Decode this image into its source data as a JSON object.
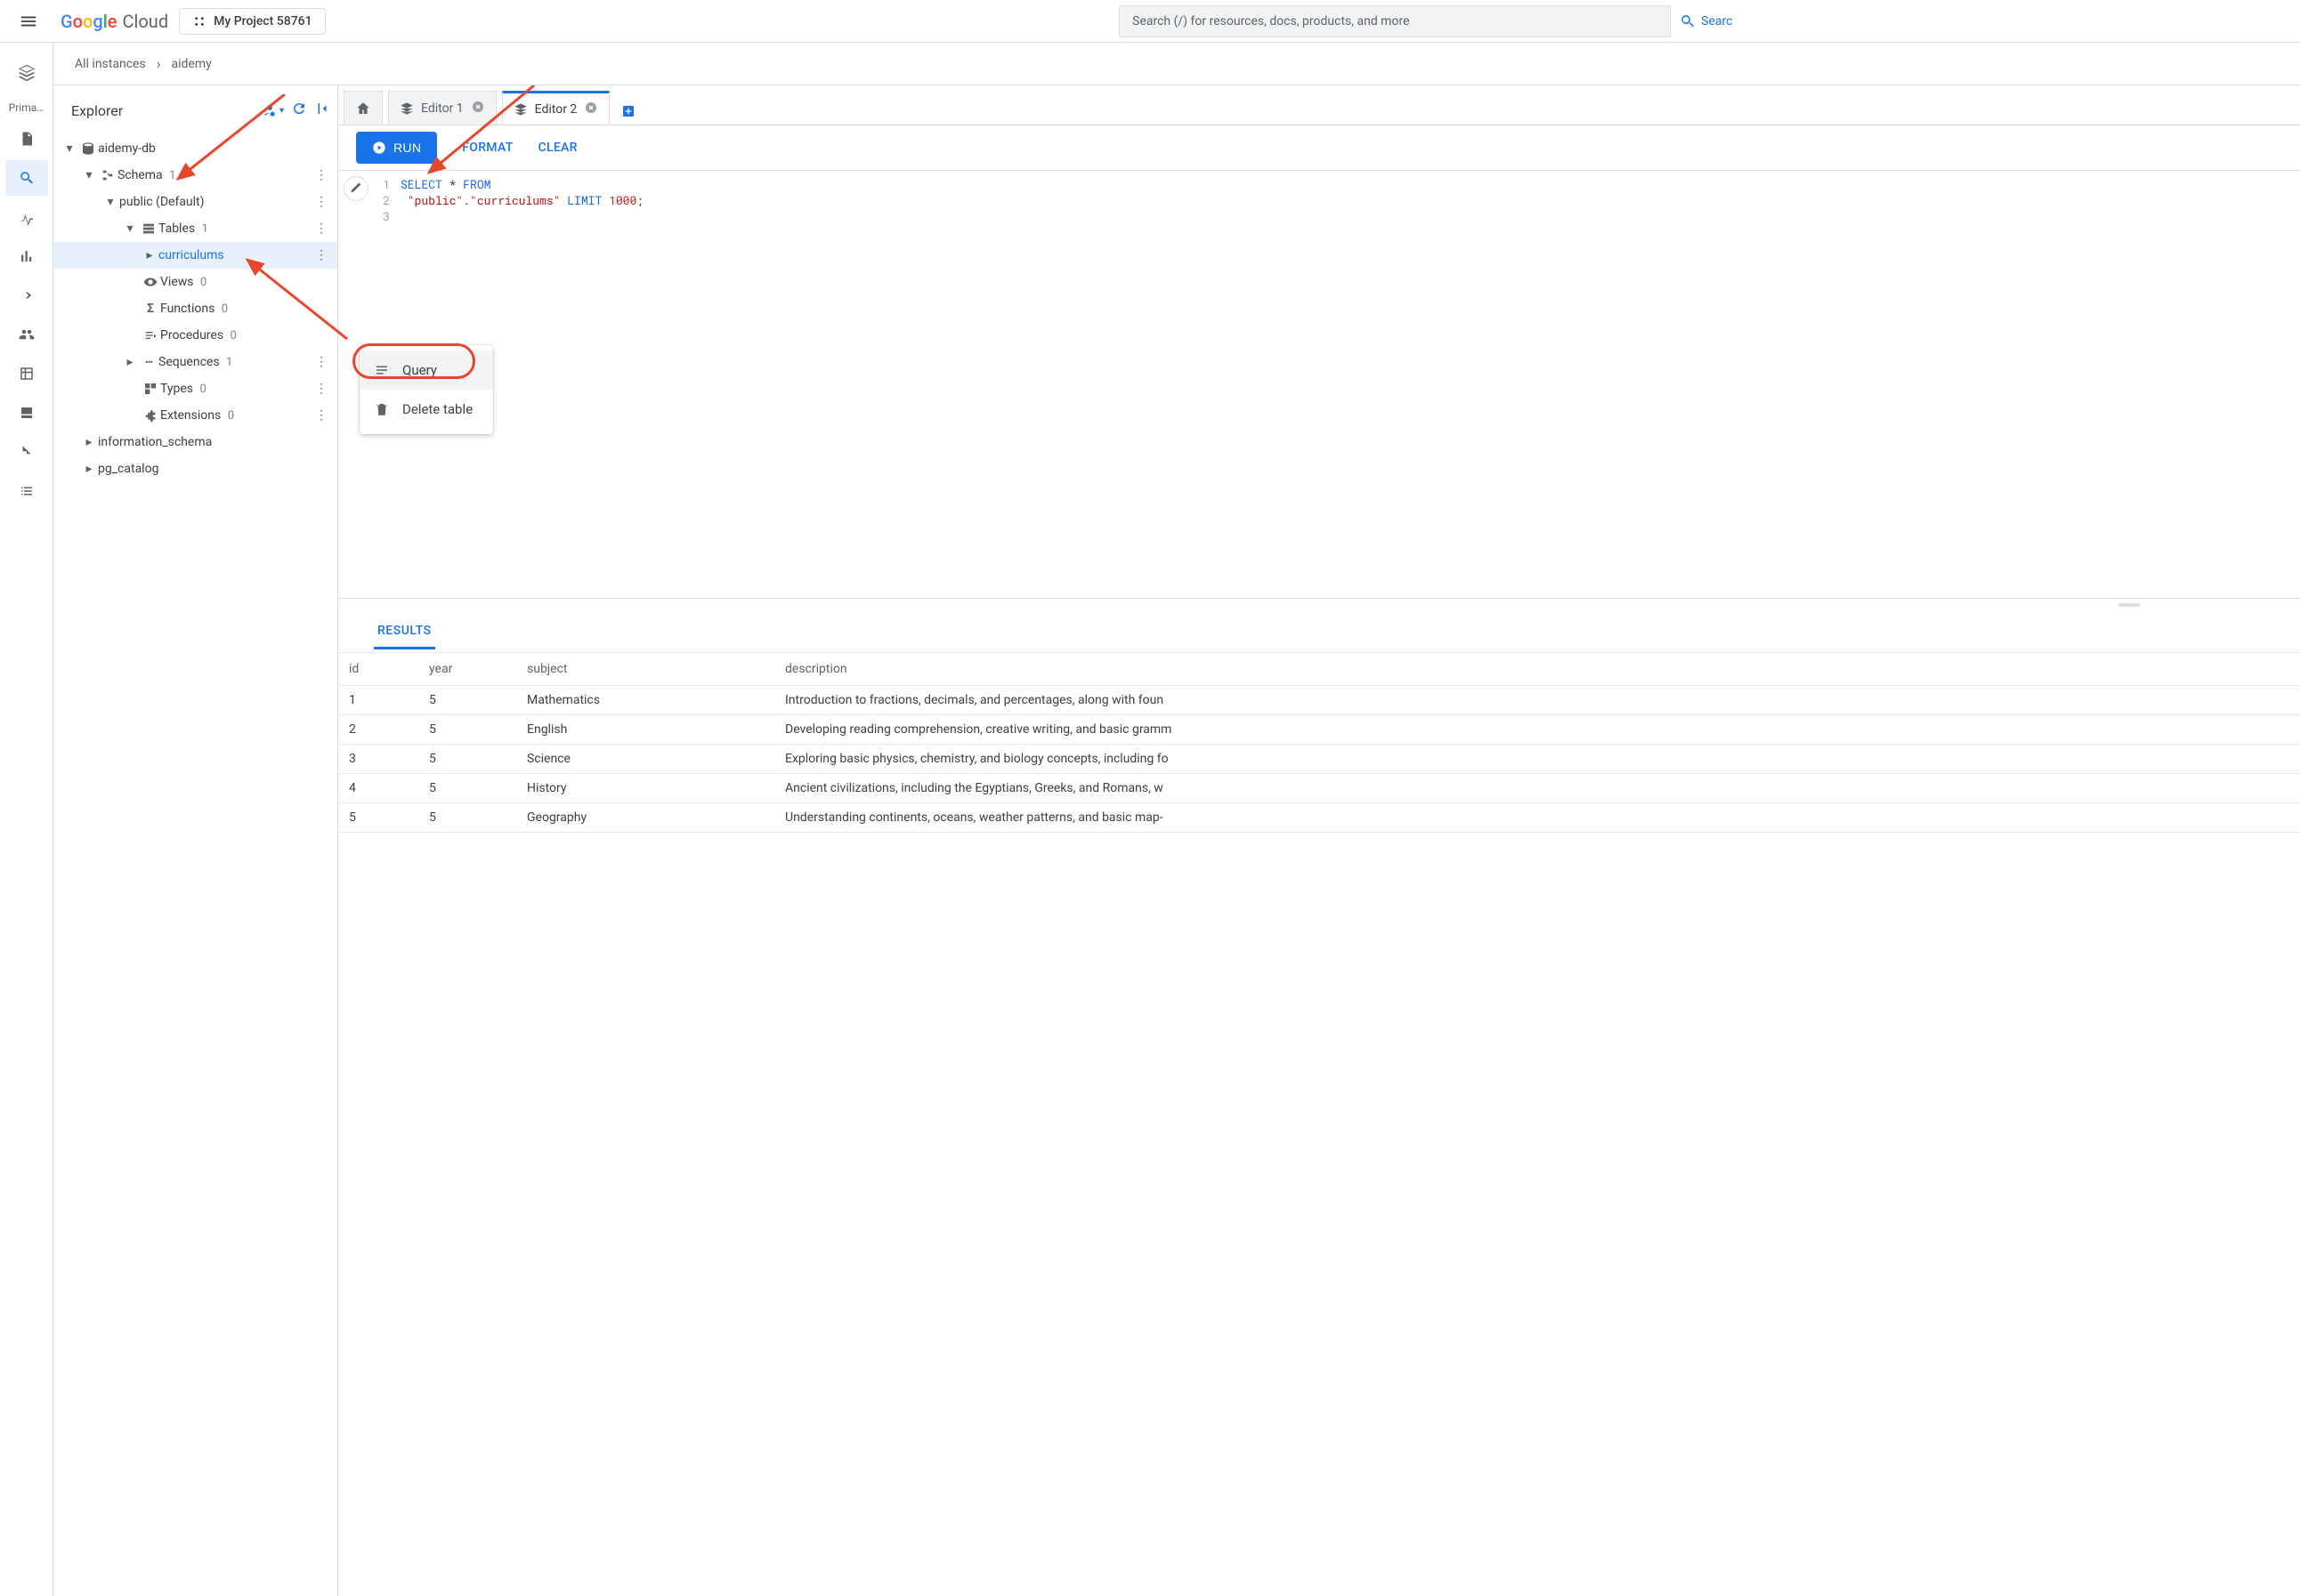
{
  "header": {
    "logo_cloud": "Cloud",
    "project": "My Project 58761",
    "search_placeholder": "Search (/) for resources, docs, products, and more",
    "search_button": "Searc"
  },
  "rail": {
    "section_label": "Prima…"
  },
  "breadcrumb": {
    "root": "All instances",
    "current": "aidemy"
  },
  "explorer": {
    "title": "Explorer",
    "db": "aidemy-db",
    "schema_label": "Schema",
    "schema_count": "1",
    "public_label": "public (Default)",
    "tables_label": "Tables",
    "tables_count": "1",
    "table_curriculums": "curriculums",
    "views_label": "Views",
    "views_count": "0",
    "functions_label": "Functions",
    "functions_count": "0",
    "procedures_label": "Procedures",
    "procedures_count": "0",
    "sequences_label": "Sequences",
    "sequences_count": "1",
    "types_label": "Types",
    "types_count": "0",
    "extensions_label": "Extensions",
    "extensions_count": "0",
    "information_schema": "information_schema",
    "pg_catalog": "pg_catalog"
  },
  "ctx": {
    "query": "Query",
    "delete": "Delete table"
  },
  "tabs": {
    "editor1": "Editor 1",
    "editor2": "Editor 2"
  },
  "toolbar": {
    "run": "RUN",
    "format": "FORMAT",
    "clear": "CLEAR"
  },
  "code": {
    "l1_a": "SELECT",
    "l1_b": " * ",
    "l1_c": "FROM",
    "l2_a": " \"public\"",
    "l2_b": ".",
    "l2_c": "\"curriculums\"",
    "l2_d": " LIMIT ",
    "l2_e": "1000",
    "l2_f": ";"
  },
  "results": {
    "tab": "RESULTS",
    "cols": {
      "id": "id",
      "year": "year",
      "subject": "subject",
      "description": "description"
    },
    "rows": [
      {
        "id": "1",
        "year": "5",
        "subject": "Mathematics",
        "description": "Introduction to fractions, decimals, and percentages, along with foun"
      },
      {
        "id": "2",
        "year": "5",
        "subject": "English",
        "description": "Developing reading comprehension, creative writing, and basic gramm"
      },
      {
        "id": "3",
        "year": "5",
        "subject": "Science",
        "description": "Exploring basic physics, chemistry, and biology concepts, including fo"
      },
      {
        "id": "4",
        "year": "5",
        "subject": "History",
        "description": "Ancient civilizations, including the Egyptians, Greeks, and Romans, w"
      },
      {
        "id": "5",
        "year": "5",
        "subject": "Geography",
        "description": "Understanding continents, oceans, weather patterns, and basic map-"
      }
    ]
  }
}
